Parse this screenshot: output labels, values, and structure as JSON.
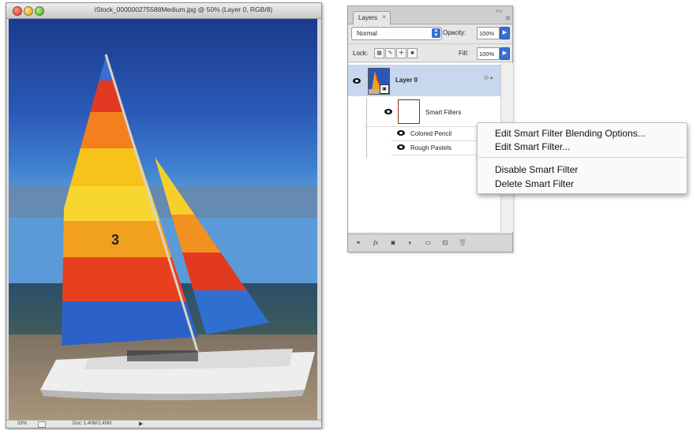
{
  "document": {
    "title": "iStock_000000275588Medium.jpg @ 50% (Layer 0, RGB/8)",
    "status_zoom": "33%",
    "status_info": "Doc: 1.40M/1.40M",
    "status_arrow": "▶"
  },
  "layers_panel": {
    "tab_label": "Layers",
    "tab_close": "×",
    "collapse_icon": "««",
    "menu_icon": "≡",
    "blend_mode": "Normal",
    "opacity_label": "Opacity:",
    "opacity_value": "100%",
    "lock_label": "Lock:",
    "fill_label": "Fill:",
    "fill_value": "100%",
    "layer_name": "Layer 0",
    "smart_filters_label": "Smart Filters",
    "filters": [
      "Colored Pencil",
      "Rough Pastels"
    ]
  },
  "context_menu": {
    "items": [
      "Edit Smart Filter Blending Options...",
      "Edit Smart Filter...",
      "Disable Smart Filter",
      "Delete Smart Filter"
    ]
  }
}
